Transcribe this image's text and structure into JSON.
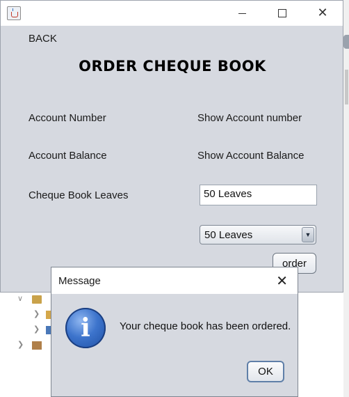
{
  "window": {
    "title": "",
    "controls": {
      "minimize": "—",
      "maximize": "□",
      "close": "✕"
    }
  },
  "form": {
    "back_label": "BACK",
    "heading": "ORDER CHEQUE BOOK",
    "account_number_label": "Account Number",
    "account_number_value": "Show Account number",
    "account_balance_label": "Account Balance",
    "account_balance_value": "Show Account Balance",
    "cheque_leaves_label": "Cheque Book Leaves",
    "cheque_leaves_field_value": "50 Leaves",
    "leaves_select_value": "50 Leaves",
    "order_button": "order"
  },
  "dialog": {
    "title": "Message",
    "message": "Your cheque book has been ordered.",
    "ok_button": "OK",
    "icon": "info-icon"
  },
  "colors": {
    "frame_bg": "#d6d9e0",
    "info_blue": "#3d74cc"
  }
}
